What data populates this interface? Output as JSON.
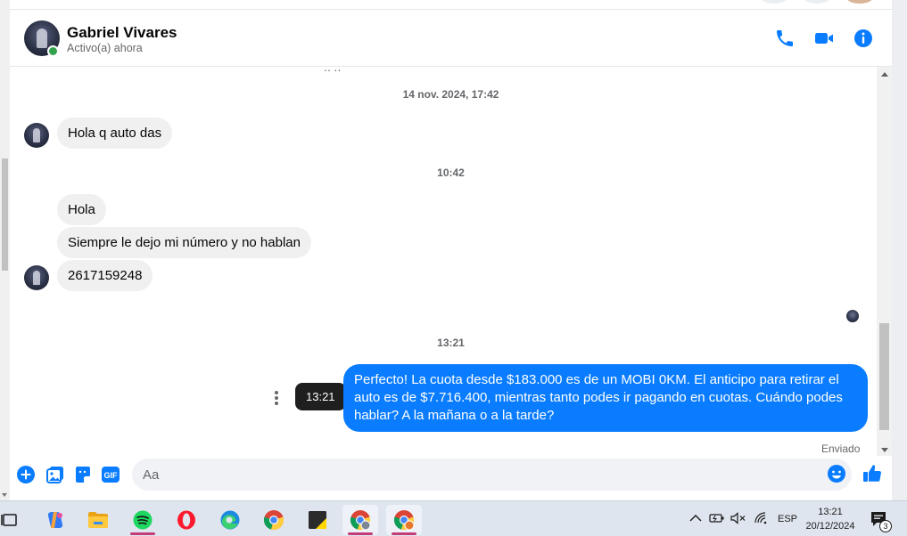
{
  "header": {
    "contact_name": "Gabriel Vivares",
    "status": "Activo(a) ahora",
    "actions": [
      "phone-icon",
      "video-camera-icon",
      "info-icon"
    ]
  },
  "messages": {
    "timestamps": [
      "14 nov. 2024, 17:42",
      "10:42",
      "13:21"
    ],
    "incoming": [
      {
        "text": "Hola q auto das"
      },
      {
        "text": "Hola"
      },
      {
        "text": "Siempre le dejo mi número y no hablan"
      },
      {
        "text": "2617159248"
      }
    ],
    "outgoing": [
      {
        "text": "Perfecto! La cuota desde $183.000 es de un MOBI 0KM. El anticipo para retirar el auto es de $7.716.400, mientras tanto podes ir pagando en cuotas. Cuándo podes hablar? A la mañana o a la tarde?"
      }
    ],
    "hover_time": "13:21",
    "status": "Enviado"
  },
  "composer": {
    "placeholder": "Aa",
    "tools": [
      "add-icon",
      "image-icon",
      "sticker-icon",
      "gif-icon"
    ],
    "gif_label": "GIF",
    "emoji_icon": "emoji-icon",
    "like_icon": "thumbs-up-icon"
  },
  "taskbar": {
    "apps": [
      "task-view",
      "copilot",
      "file-explorer",
      "spotify",
      "opera",
      "edge",
      "chrome",
      "sticky-notes",
      "chrome-profile-1",
      "chrome-profile-2"
    ],
    "tray": {
      "language": "ESP",
      "time": "13:21",
      "date": "20/12/2024",
      "notifications": "3"
    }
  },
  "colors": {
    "messenger_blue": "#0a7cff",
    "online_green": "#31a24c",
    "incoming_bubble": "#f0f0f0"
  }
}
